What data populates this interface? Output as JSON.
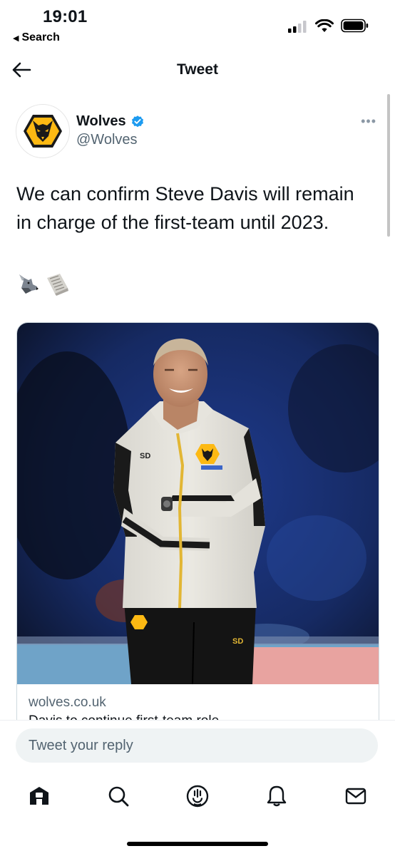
{
  "status_bar": {
    "time": "19:01",
    "back_label": "Search",
    "back_glyph": "◀"
  },
  "nav": {
    "title": "Tweet",
    "back_icon": "arrow-left-icon"
  },
  "author": {
    "name": "Wolves",
    "handle": "@Wolves",
    "verified": true,
    "more_label": "•••"
  },
  "tweet": {
    "text": "We can confirm Steve Davis will remain in charge of the first-team until 2023.",
    "emojis": [
      "🐺",
      "🗞️"
    ]
  },
  "card": {
    "domain": "wolves.co.uk",
    "title": "Davis to continue first-team role"
  },
  "reply": {
    "placeholder": "Tweet your reply"
  },
  "tabs": [
    {
      "icon": "home-icon"
    },
    {
      "icon": "search-icon"
    },
    {
      "icon": "spaces-icon"
    },
    {
      "icon": "bell-icon"
    },
    {
      "icon": "mail-icon"
    }
  ],
  "colors": {
    "accent": "#1d9bf0",
    "gold": "#fdb913",
    "text": "#0f1419",
    "secondary": "#536471"
  }
}
